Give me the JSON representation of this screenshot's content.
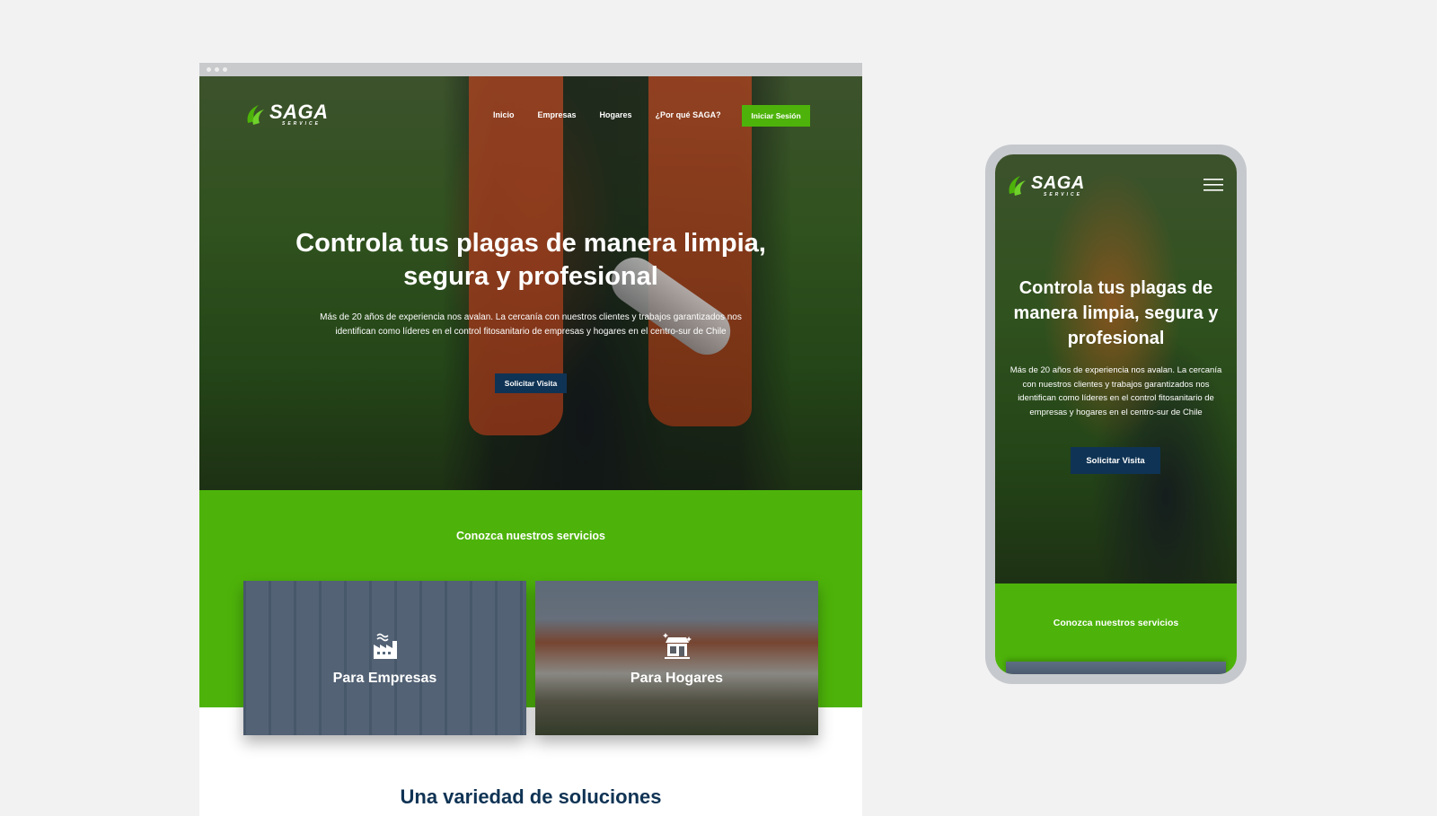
{
  "brand": {
    "name": "SAGA",
    "tagline": "SERVICE",
    "primary_color": "#4db30a",
    "dark_color": "#0f3354"
  },
  "desktop": {
    "nav": {
      "items": [
        {
          "label": "Inicio"
        },
        {
          "label": "Empresas"
        },
        {
          "label": "Hogares"
        },
        {
          "label": "¿Por qué SAGA?"
        }
      ],
      "login_label": "Iniciar Sesión"
    },
    "hero": {
      "title": "Controla tus plagas de manera limpia, segura y profesional",
      "text": "Más de 20 años de experiencia nos avalan. La cercanía con nuestros clientes y trabajos garantizados nos identifican como líderes en el control fitosanitario de empresas y hogares en el centro-sur de Chile",
      "cta_label": "Solicitar Visita"
    },
    "services": {
      "title": "Conozca nuestros servicios",
      "cards": [
        {
          "label": "Para Empresas",
          "icon": "factory-icon"
        },
        {
          "label": "Para Hogares",
          "icon": "house-sparkle-icon"
        }
      ]
    },
    "solutions_title": "Una variedad de soluciones"
  },
  "mobile": {
    "hero": {
      "title": "Controla tus plagas de manera limpia, segura y profesional",
      "text": "Más de 20 años de experiencia nos avalan. La cercanía con nuestros clientes y trabajos garantizados nos identifican como líderes en el control fitosanitario de empresas y hogares en el centro-sur de Chile",
      "cta_label": "Solicitar Visita"
    },
    "services_title": "Conozca nuestros servicios",
    "menu_icon": "hamburger-menu-icon"
  }
}
